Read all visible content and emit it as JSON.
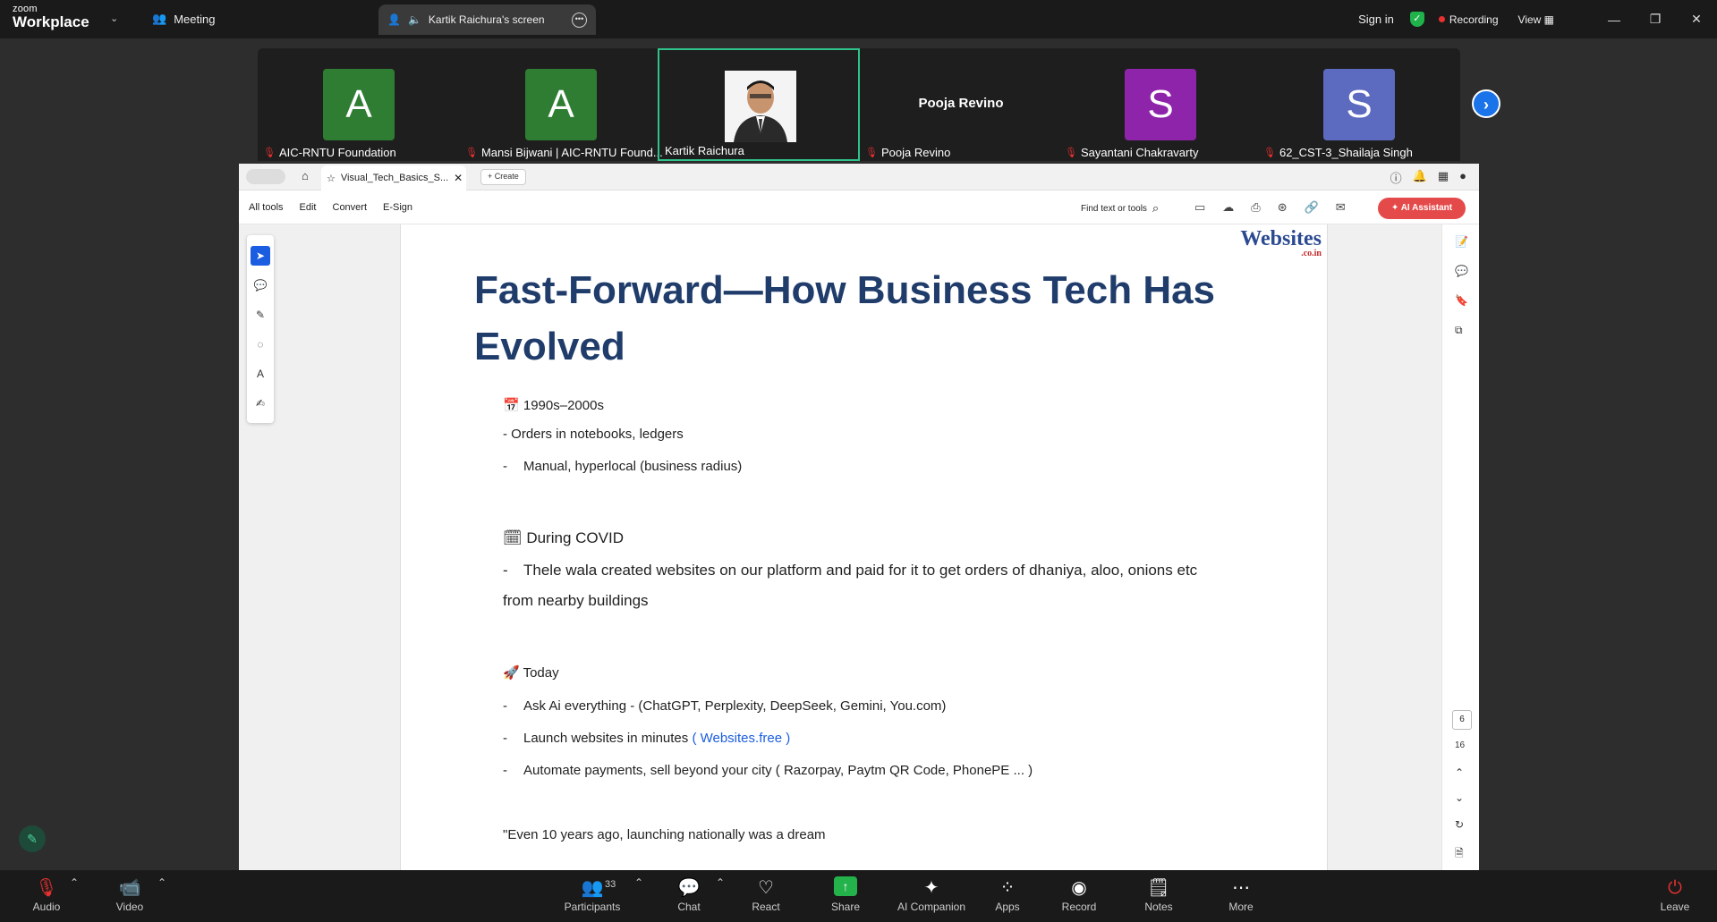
{
  "titlebar": {
    "brand_top": "zoom",
    "brand_bottom": "Workplace",
    "meeting_label": "Meeting",
    "share_tab_label": "Kartik Raichura's screen",
    "sign_in": "Sign in",
    "recording": "Recording",
    "view": "View"
  },
  "participants": [
    {
      "name": "AIC-RNTU Foundation",
      "initial": "A",
      "color": "#2e7d32"
    },
    {
      "name": "Mansi Bijwani | AIC-RNTU Found...",
      "initial": "A",
      "color": "#2e7d32"
    },
    {
      "name": "Kartik Raichura"
    },
    {
      "name": "Pooja Revino",
      "display": "Pooja Revino"
    },
    {
      "name": "Sayantani Chakravarty",
      "initial": "S",
      "color": "#8e24aa"
    },
    {
      "name": "62_CST-3_Shailaja Singh",
      "initial": "S",
      "color": "#5c6bc0"
    }
  ],
  "acrobat": {
    "doc_tab": "Visual_Tech_Basics_S...",
    "create": "Create",
    "menu": [
      "All tools",
      "Edit",
      "Convert",
      "E-Sign"
    ],
    "find": "Find text or tools",
    "ai_assistant": "AI Assistant",
    "page_current": "6",
    "page_total": "16"
  },
  "slide": {
    "logo_main": "Websites",
    "logo_sub": ".co.in",
    "title": "Fast-Forward—How Business Tech Has Evolved",
    "s1_head": "1990s–2000s",
    "s1_b1": "- Orders in notebooks, ledgers",
    "s1_b2": "Manual, hyperlocal (business radius)",
    "s2_head": "During COVID",
    "s2_b1": "Thele wala created websites on our platform and paid for it to get orders of dhaniya, aloo, onions etc",
    "s2_b1b": "from nearby buildings",
    "s3_head": "Today",
    "s3_b1": "Ask Ai everything - (ChatGPT, Perplexity, DeepSeek, Gemini, You.com)",
    "s3_b2": "Launch websites in minutes",
    "s3_b2_link": "( Websites.free )",
    "s3_b3": "Automate payments, sell beyond your city ( Razorpay, Paytm QR Code, PhonePE ... )",
    "quote": "\"Even 10 years ago, launching nationally was a dream",
    "dash": "-"
  },
  "toolbar": {
    "audio": "Audio",
    "video": "Video",
    "participants": "Participants",
    "participants_count": "33",
    "chat": "Chat",
    "react": "React",
    "share": "Share",
    "ai_companion": "AI Companion",
    "apps": "Apps",
    "record": "Record",
    "notes": "Notes",
    "more": "More",
    "leave": "Leave"
  }
}
